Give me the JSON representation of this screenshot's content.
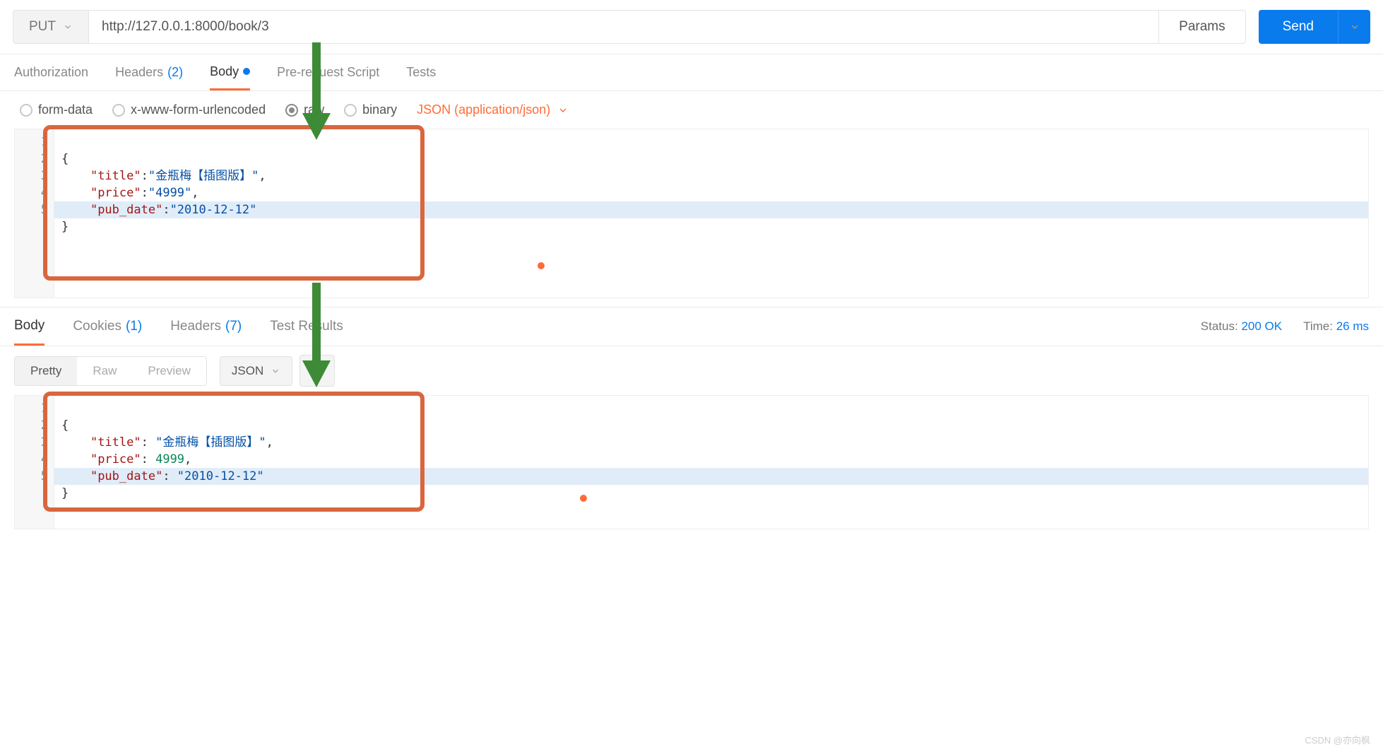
{
  "request": {
    "method": "PUT",
    "url": "http://127.0.0.1:8000/book/3",
    "params_button": "Params",
    "send_button": "Send"
  },
  "req_tabs": {
    "authorization": "Authorization",
    "headers_label": "Headers",
    "headers_count": "(2)",
    "body": "Body",
    "prerequest": "Pre-request Script",
    "tests": "Tests"
  },
  "body_types": {
    "form_data": "form-data",
    "urlencoded": "x-www-form-urlencoded",
    "raw": "raw",
    "binary": "binary",
    "content_type": "JSON (application/json)"
  },
  "req_body_lines": [
    "1",
    "2",
    "3",
    "4",
    "5"
  ],
  "req_body": {
    "l1": "{",
    "l2_k": "\"title\"",
    "l2_c": ":",
    "l2_v": "\"金瓶梅【插图版】\"",
    "l2_e": ",",
    "l3_k": "\"price\"",
    "l3_c": ":",
    "l3_v": "\"4999\"",
    "l3_e": ",",
    "l4_k": "\"pub_date\"",
    "l4_c": ":",
    "l4_v": "\"2010-12-12\"",
    "l5": "}"
  },
  "resp_tabs": {
    "body": "Body",
    "cookies_label": "Cookies",
    "cookies_count": "(1)",
    "headers_label": "Headers",
    "headers_count": "(7)",
    "test_results": "Test Results"
  },
  "resp_meta": {
    "status_label": "Status:",
    "status_value": "200 OK",
    "time_label": "Time:",
    "time_value": "26 ms"
  },
  "view_modes": {
    "pretty": "Pretty",
    "raw": "Raw",
    "preview": "Preview",
    "format": "JSON"
  },
  "resp_body_lines": [
    "1",
    "2",
    "3",
    "4",
    "5"
  ],
  "resp_body": {
    "l1": "{",
    "l2_k": "\"title\"",
    "l2_c": ": ",
    "l2_v": "\"金瓶梅【插图版】\"",
    "l2_e": ",",
    "l3_k": "\"price\"",
    "l3_c": ": ",
    "l3_v": "4999",
    "l3_e": ",",
    "l4_k": "\"pub_date\"",
    "l4_c": ": ",
    "l4_v": "\"2010-12-12\"",
    "l5": "}"
  },
  "watermark": "CSDN @亦向枫"
}
